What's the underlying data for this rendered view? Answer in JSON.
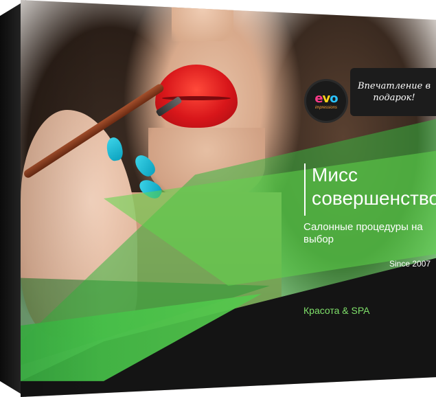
{
  "brand": {
    "logo_alt": "evo impressions"
  },
  "tagline": "Впечатление в подарок!",
  "product": {
    "title": "Мисс совершенство",
    "subtitle": "Салонные процедуры на выбор",
    "since": "Since 2007",
    "category": "Красота & SPA"
  },
  "colors": {
    "accent_green": "#4cc54a",
    "dark_band": "#141414",
    "lip_red": "#d8161a",
    "nail_blue": "#1cbad6"
  },
  "icons": [
    "evo-logo-icon"
  ]
}
